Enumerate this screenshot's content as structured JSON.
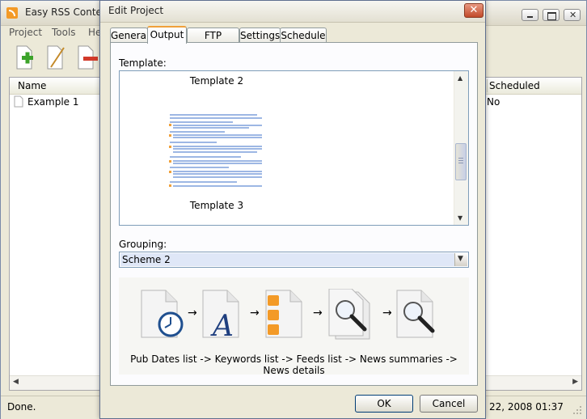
{
  "main_window": {
    "title": "Easy RSS Content",
    "menu": [
      "Project",
      "Tools",
      "He"
    ],
    "columns": {
      "name": "Name",
      "scheduled": "Scheduled"
    },
    "rows": [
      {
        "name": "Example 1",
        "scheduled": "No"
      }
    ],
    "status_left": "Done.",
    "status_right": "22, 2008 01:37",
    "toolbar_icons": [
      "add-project-icon",
      "edit-project-icon",
      "delete-project-icon"
    ]
  },
  "dialog": {
    "title": "Edit Project",
    "close_glyph": "✕",
    "tabs": [
      "General",
      "Output",
      "FTP upload",
      "Settings",
      "Schedule"
    ],
    "active_tab": "Output",
    "template_label": "Template:",
    "templates": [
      "Template 2",
      "Template 3"
    ],
    "grouping_label": "Grouping:",
    "grouping_value": "Scheme 2",
    "flow_caption": "Pub Dates list -> Keywords list -> Feeds list -> News summaries -> News details",
    "flow_icons": [
      "pub-dates-icon",
      "keywords-icon",
      "feeds-icon",
      "news-summaries-icon",
      "news-details-icon"
    ],
    "arrow_glyph": "→",
    "ok_label": "OK",
    "cancel_label": "Cancel"
  },
  "colors": {
    "accent_tab": "#f0a13b",
    "selection": "#dfe7f7",
    "dialog_bg": "#ece9d8"
  }
}
